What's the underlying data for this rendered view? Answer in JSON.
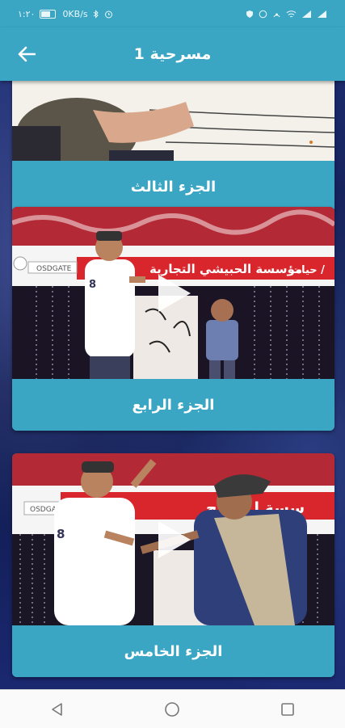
{
  "status": {
    "time": "١:٢٠",
    "speed": "0KB/s",
    "battery": ""
  },
  "appbar": {
    "title": "مسرحية 1"
  },
  "cards": [
    {
      "label": "الجزء الثالث"
    },
    {
      "label": "الجزء الرابع",
      "banner": "مؤسسة الحبيشي التجارية",
      "banner_side": "حيات /"
    },
    {
      "label": "الجزء الخامس",
      "banner": "سسة ا   ة التج"
    }
  ],
  "icons": {
    "back": "arrow-left-icon",
    "play": "play-icon",
    "nav_back": "triangle-back-icon",
    "nav_home": "circle-home-icon",
    "nav_recent": "square-recent-icon"
  },
  "colors": {
    "accent": "#3aa6c4",
    "banner_red": "#d8262c"
  }
}
